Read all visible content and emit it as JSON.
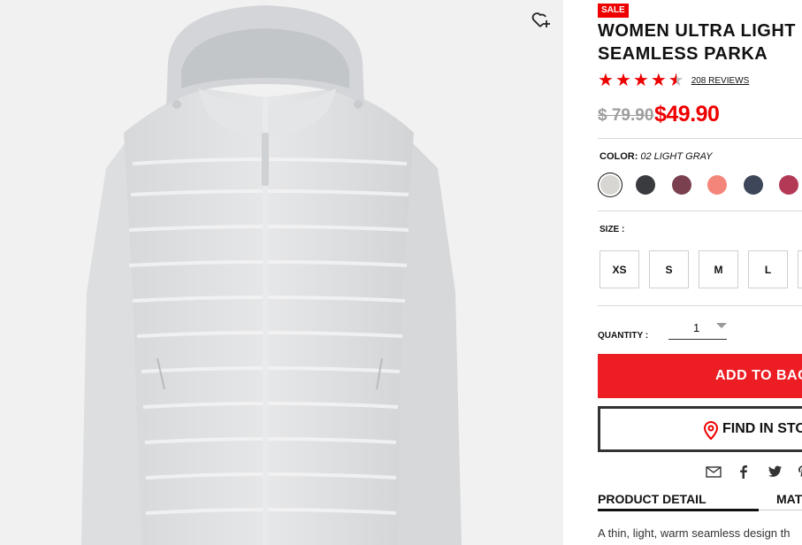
{
  "product": {
    "badge": "SALE",
    "title_line1": "WOMEN ULTRA LIGHT D",
    "title_line2": "SEAMLESS PARKA",
    "rating": 4.5,
    "reviews": "208 REVIEWS",
    "old_price": "$ 79.90",
    "new_price": "$49.90"
  },
  "color": {
    "label": "COLOR:",
    "selected": "02 LIGHT GRAY",
    "swatches": [
      "#d8d6d2",
      "#3a3b3e",
      "#7a4050",
      "#f4857a",
      "#3d4759",
      "#b33a57"
    ]
  },
  "size": {
    "label": "SIZE :",
    "options": [
      "XS",
      "S",
      "M",
      "L"
    ]
  },
  "quantity": {
    "label": "QUANTITY :",
    "value": "1"
  },
  "actions": {
    "add_to_bag": "ADD TO BAG",
    "find_in_store": "FIND IN STORE"
  },
  "tabs": {
    "product_detail": "PRODUCT DETAIL",
    "materials": "MAT"
  },
  "description": "A thin, light, warm seamless design th",
  "colors": {
    "brand_red": "#ed1d24"
  }
}
